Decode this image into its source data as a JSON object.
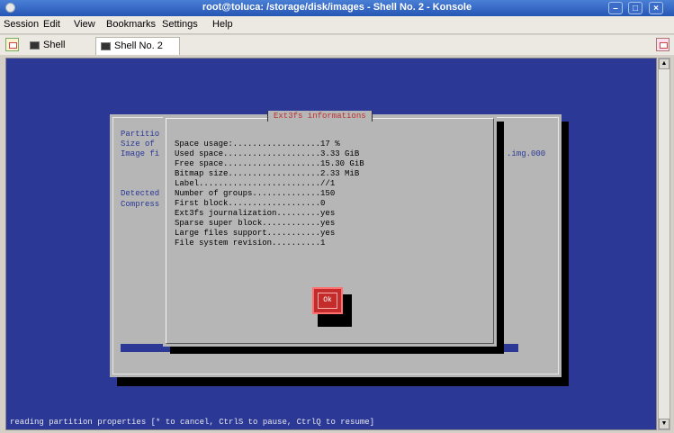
{
  "window": {
    "title": "root@toluca: /storage/disk/images - Shell No. 2 - Konsole"
  },
  "menu": [
    "Session",
    "Edit",
    "View",
    "Bookmarks",
    "Settings",
    "Help"
  ],
  "tabs": [
    {
      "label": "Shell",
      "active": false
    },
    {
      "label": "Shell No. 2",
      "active": true
    }
  ],
  "terminal": {
    "background_color": "#2b3896",
    "bg_dialog": {
      "lines": [
        "Partitio",
        "Size of ",
        "Image fi",
        "",
        "Detected",
        "Compress"
      ],
      "right_text": ".img.000"
    },
    "dialog": {
      "title": "Ext3fs informations",
      "rows": [
        "Space usage:..................17 %",
        "Used space....................3.33 GiB",
        "Free space....................15.30 GiB",
        "Bitmap size...................2.33 MiB",
        "Label.........................//1",
        "Number of groups..............150",
        "First block...................0",
        "Ext3fs journalization.........yes",
        "Sparse super block............yes",
        "Large files support...........yes",
        "File system revision..........1"
      ],
      "ok_label": "Ok"
    },
    "status_line": "reading partition properties [* to cancel, CtrlS to pause, CtrlQ to resume]"
  }
}
